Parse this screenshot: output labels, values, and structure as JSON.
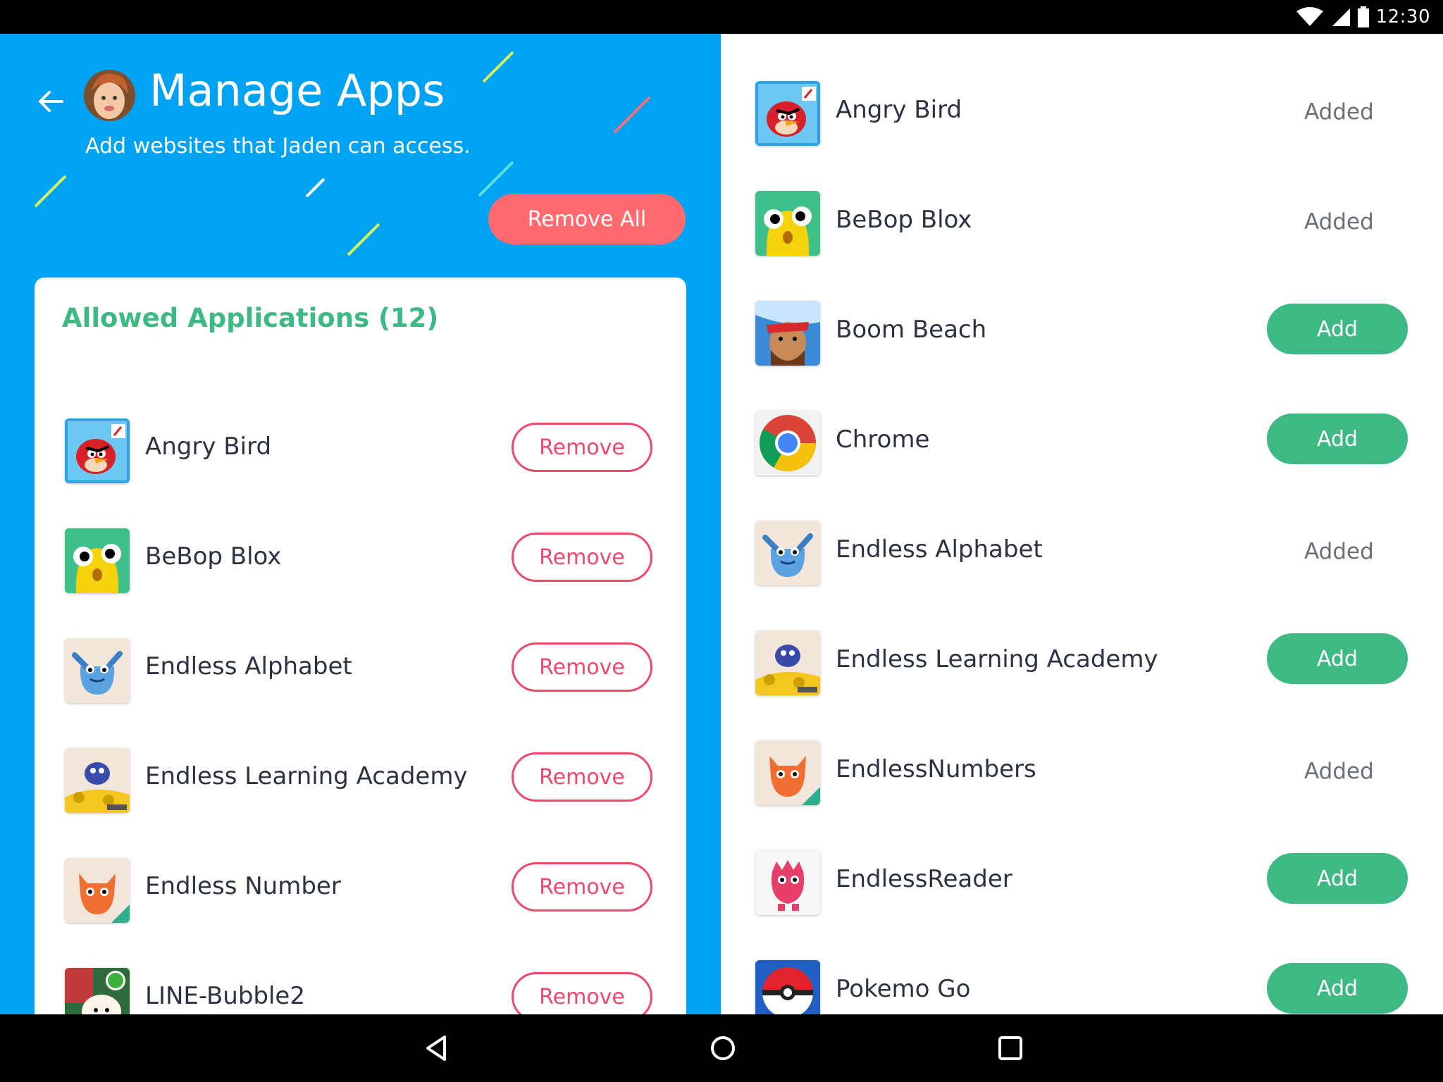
{
  "status_bar": {
    "time": "12:30"
  },
  "header": {
    "title": "Manage Apps",
    "subtitle": "Add websites that Jaden can access.",
    "remove_all_label": "Remove All"
  },
  "allowed": {
    "heading": "Allowed Applications (12)",
    "remove_label": "Remove",
    "items": [
      {
        "name": "Angry Bird",
        "icon": "angry-bird-icon"
      },
      {
        "name": "BeBop Blox",
        "icon": "bebop-blox-icon"
      },
      {
        "name": "Endless Alphabet",
        "icon": "endless-alphabet-icon"
      },
      {
        "name": "Endless Learning Academy",
        "icon": "endless-learning-academy-icon"
      },
      {
        "name": "Endless Number",
        "icon": "endless-number-icon"
      },
      {
        "name": "LINE-Bubble2",
        "icon": "line-bubble-icon"
      }
    ]
  },
  "catalog": {
    "added_label": "Added",
    "add_label": "Add",
    "items": [
      {
        "name": "Angry Bird",
        "status": "added",
        "icon": "angry-bird-icon"
      },
      {
        "name": "BeBop Blox",
        "status": "added",
        "icon": "bebop-blox-icon"
      },
      {
        "name": "Boom Beach",
        "status": "add",
        "icon": "boom-beach-icon"
      },
      {
        "name": "Chrome",
        "status": "add",
        "icon": "chrome-icon"
      },
      {
        "name": "Endless Alphabet",
        "status": "added",
        "icon": "endless-alphabet-icon"
      },
      {
        "name": "Endless Learning Academy",
        "status": "add",
        "icon": "endless-learning-academy-icon"
      },
      {
        "name": "EndlessNumbers",
        "status": "added",
        "icon": "endless-numbers-icon"
      },
      {
        "name": "EndlessReader",
        "status": "add",
        "icon": "endless-reader-icon"
      },
      {
        "name": "Pokemo Go",
        "status": "add",
        "icon": "pokeball-icon"
      }
    ]
  },
  "colors": {
    "primary_blue": "#00a2f2",
    "accent_green": "#3dba84",
    "remove_red": "#f0486a",
    "remove_all_coral": "#ff6a6f"
  },
  "nav": {
    "icons": [
      "back-triangle-icon",
      "home-circle-icon",
      "recents-square-icon"
    ]
  }
}
